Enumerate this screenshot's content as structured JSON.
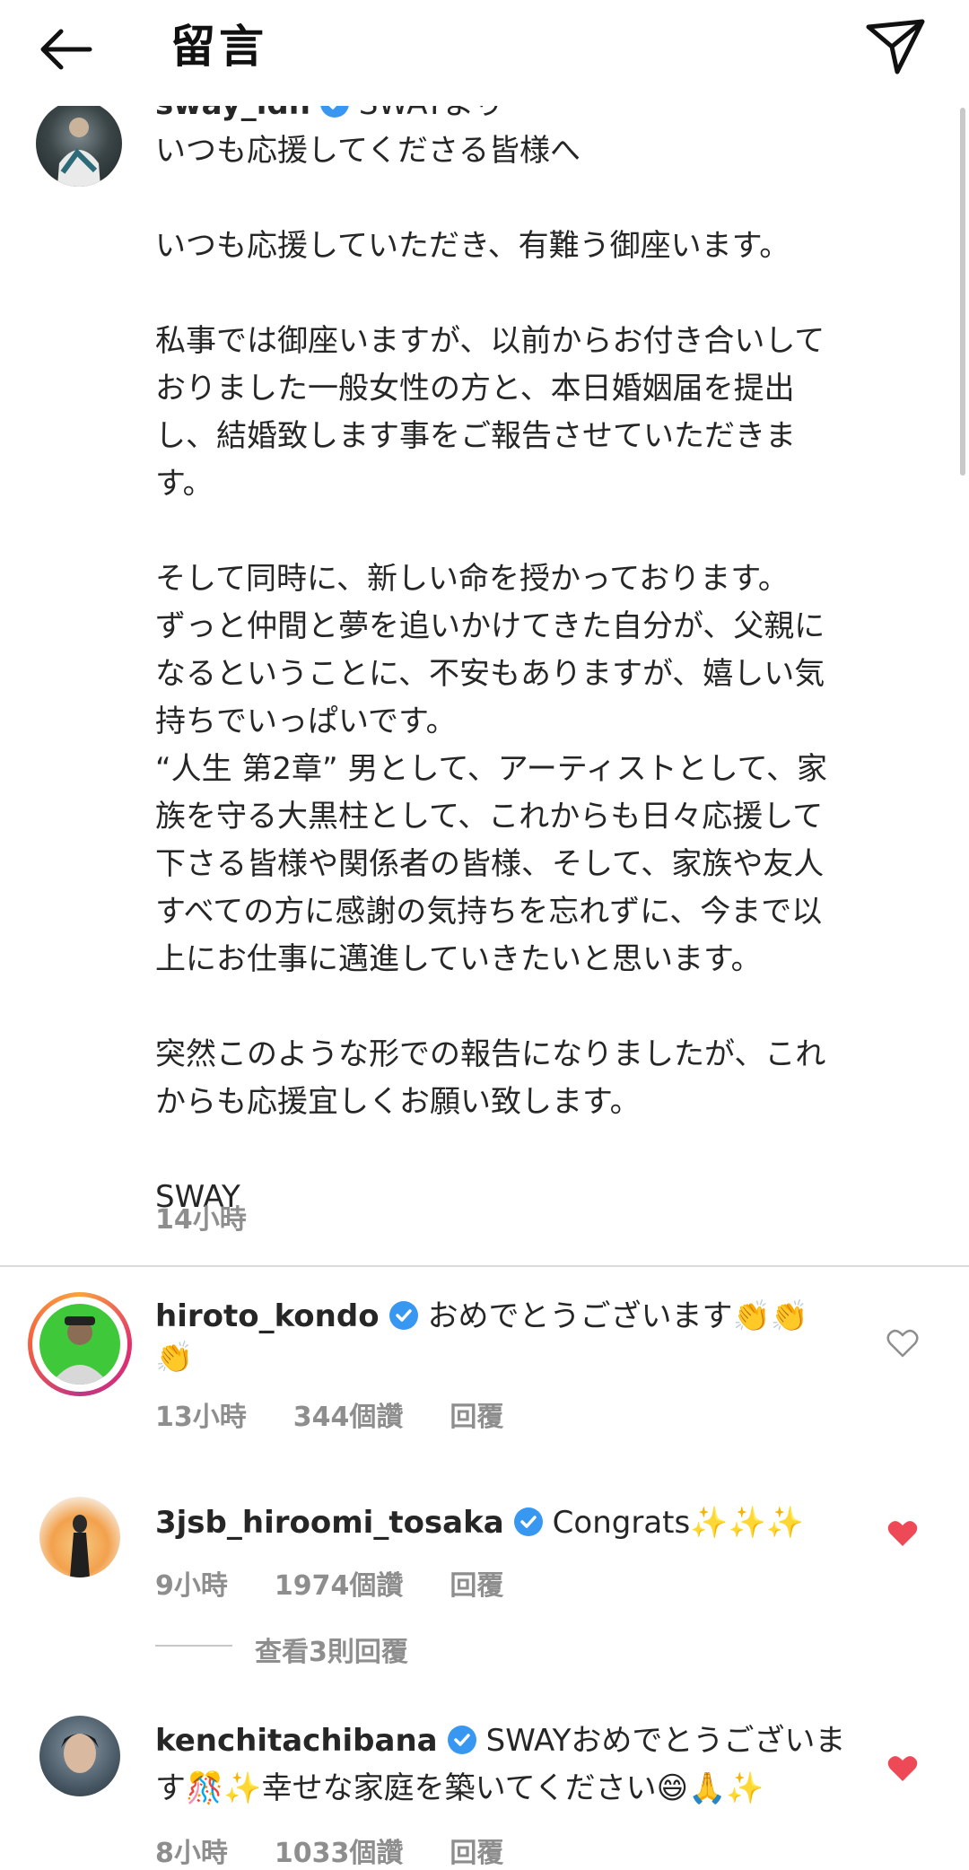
{
  "header": {
    "title": "留言"
  },
  "post": {
    "username": "sway_ldh",
    "username_suffix": "SWAYより",
    "caption": "いつも応援してくださる皆様へ\n\nいつも応援していただき、有難う御座います。\n\n私事では御座いますが、以前からお付き合いして\nおりました一般女性の方と、本日婚姻届を提出\nし、結婚致します事をご報告させていただきま\nす。\n\nそして同時に、新しい命を授かっております。\nずっと仲間と夢を追いかけてきた自分が、父親に\nなるということに、不安もありますが、嬉しい気\n持ちでいっぱいです。\n“人生 第2章” 男として、アーティストとして、家\n族を守る大黒柱として、これからも日々応援して\n下さる皆様や関係者の皆様、そして、家族や友人\nすべての方に感謝の気持ちを忘れずに、今まで以\n上にお仕事に邁進していきたいと思います。\n\n突然このような形での報告になりましたが、これ\nからも応援宜しくお願い致します。\n\nSWAY",
    "time": "14小時"
  },
  "comments": [
    {
      "username": "hiroto_kondo",
      "text": "おめでとうございます👏👏",
      "text_line2": "👏",
      "time": "13小時",
      "likes": "344個讚",
      "reply": "回覆",
      "liked": false
    },
    {
      "username": "3jsb_hiroomi_tosaka",
      "text": "Congrats✨✨✨",
      "time": "9小時",
      "likes": "1974個讚",
      "reply": "回覆",
      "liked": true,
      "view_replies": "查看3則回覆"
    },
    {
      "username": "kenchitachibana",
      "text": "SWAYおめでとうございま",
      "text_line2": "す🎊✨幸せな家庭を築いてください😄🙏✨",
      "time": "8小時",
      "likes": "1033個讚",
      "reply": "回覆",
      "liked": true
    }
  ],
  "colors": {
    "verified": "#3897f0",
    "heart_liked": "#ed4956",
    "meta": "#8e8e8e"
  },
  "icons": [
    "back-arrow-icon",
    "send-icon",
    "verified-badge-icon",
    "heart-icon"
  ]
}
